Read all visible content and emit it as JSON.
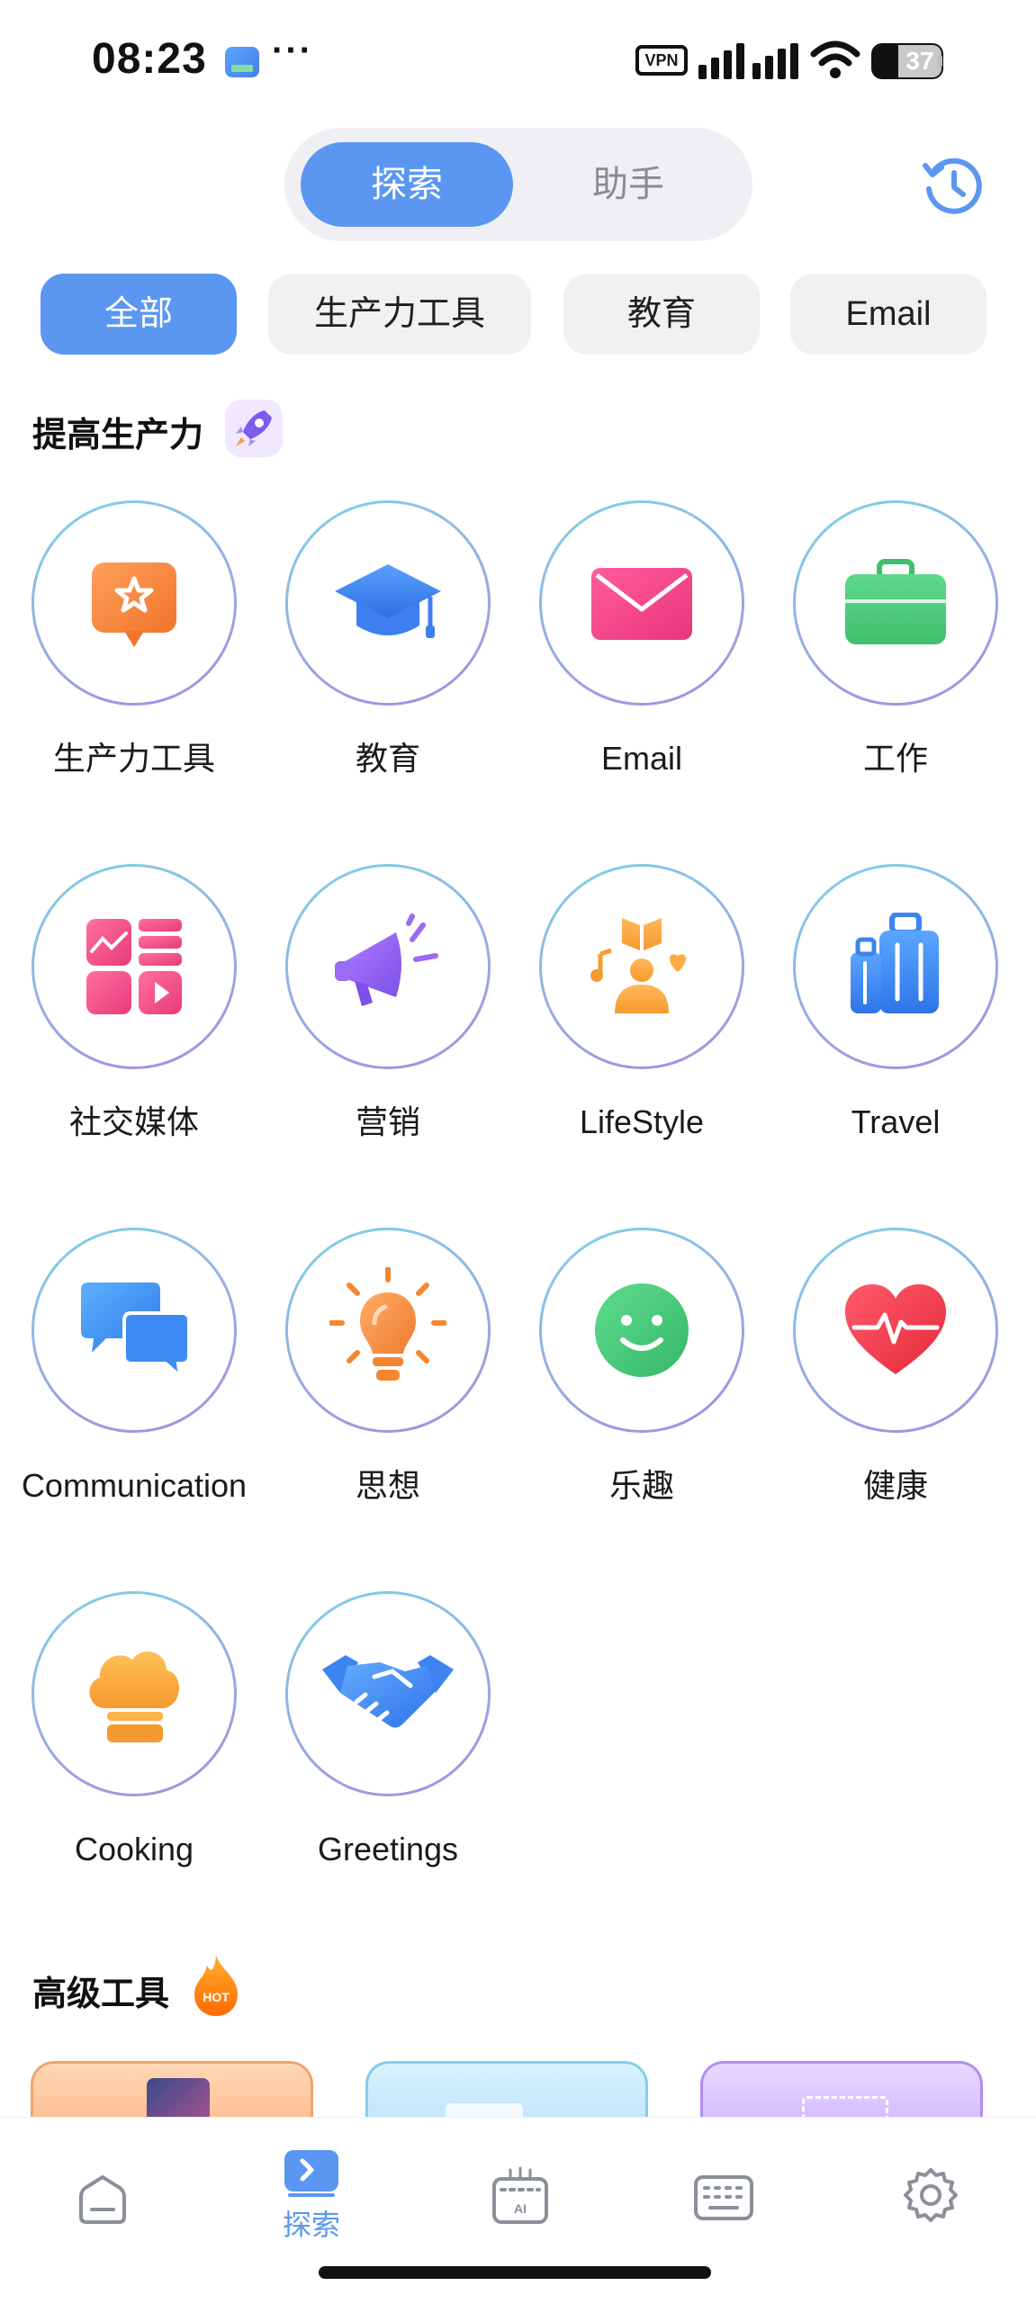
{
  "status_bar": {
    "time": "08:23",
    "more": "···",
    "vpn": "VPN",
    "battery": "37"
  },
  "tabs": {
    "explore": "探索",
    "assistant": "助手"
  },
  "filters": [
    "全部",
    "生产力工具",
    "教育",
    "Email"
  ],
  "sections": {
    "productivity_title": "提高生产力",
    "advanced_title": "高级工具",
    "hot_badge": "HOT"
  },
  "categories": [
    {
      "label": "生产力工具",
      "icon": "star-speech-bubble-icon"
    },
    {
      "label": "教育",
      "icon": "graduation-cap-icon"
    },
    {
      "label": "Email",
      "icon": "envelope-icon"
    },
    {
      "label": "工作",
      "icon": "briefcase-icon"
    },
    {
      "label": "社交媒体",
      "icon": "social-media-grid-icon"
    },
    {
      "label": "营销",
      "icon": "megaphone-icon"
    },
    {
      "label": "LifeStyle",
      "icon": "lifestyle-icon"
    },
    {
      "label": "Travel",
      "icon": "luggage-icon"
    },
    {
      "label": "Communication",
      "icon": "chat-bubbles-icon"
    },
    {
      "label": "思想",
      "icon": "lightbulb-icon"
    },
    {
      "label": "乐趣",
      "icon": "smiley-icon"
    },
    {
      "label": "健康",
      "icon": "heart-pulse-icon"
    },
    {
      "label": "Cooking",
      "icon": "chef-hat-icon"
    },
    {
      "label": "Greetings",
      "icon": "handshake-icon"
    }
  ],
  "bottom_nav": {
    "active_label": "探索",
    "items": [
      "home-icon",
      "explore-icon",
      "ai-keyboard-icon",
      "keyboard-icon",
      "settings-icon"
    ]
  },
  "colors": {
    "accent": "#5b97f0",
    "chip_bg": "#f1f1f4",
    "circle_border_start": "#7fd3e8",
    "circle_border_end": "#a98be0"
  }
}
